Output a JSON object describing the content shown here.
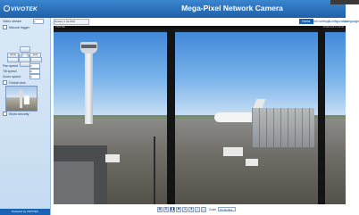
{
  "header": {
    "logo": "VIVOTEK",
    "title": "Mega-Pixel Network Camera"
  },
  "nav": {
    "items": [
      "Home",
      "Client settings",
      "Configuration",
      "Language"
    ]
  },
  "stream": {
    "label": "Stream 1 (H.264)"
  },
  "left_panel": {
    "video_stream_label": "Video stream",
    "video_stream_value": "1",
    "manual_trigger_label": "Manual trigger",
    "ptz_buttons": {
      "home": "Home",
      "auto": "Auto"
    },
    "pan_speed_label": "Pan speed",
    "pan_speed_value": "0",
    "tilt_speed_label": "Tilt speed",
    "tilt_speed_value": "0",
    "zoom_speed_label": "Zoom speed",
    "zoom_speed_value": "0",
    "global_view_label": "Global view",
    "show_security_label": "Show security",
    "footer": "Powered by VIVOTEK"
  },
  "video": {
    "top_left": "VIVOTEK",
    "top_right": "2010/11/16 11:39:40"
  },
  "toolbar": {
    "zoom_label": "Zoom",
    "zoom_value": "Fit window"
  }
}
